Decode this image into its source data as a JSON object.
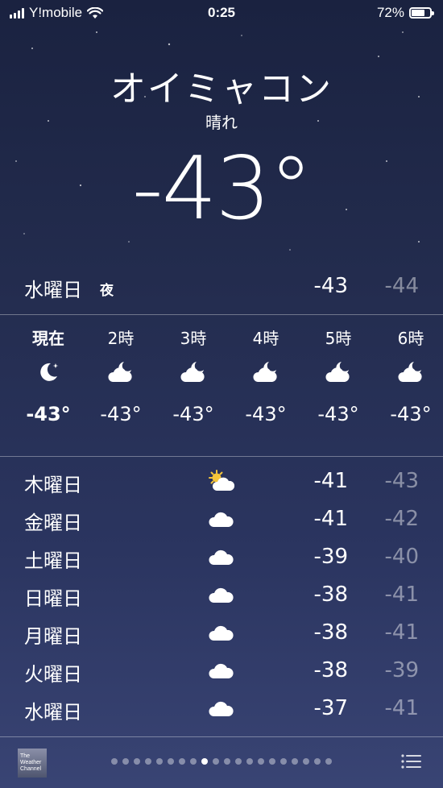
{
  "status_bar": {
    "carrier": "Y!mobile",
    "time": "0:25",
    "battery": "72%"
  },
  "location": {
    "city": "オイミャコン",
    "condition": "晴れ",
    "current_temp": "-43°"
  },
  "today": {
    "day": "水曜日",
    "tag": "夜",
    "high": "-43",
    "low": "-44"
  },
  "hourly": [
    {
      "label": "現在",
      "icon": "moon-icon",
      "temp": "-43°"
    },
    {
      "label": "2時",
      "icon": "moon-cloud-icon",
      "temp": "-43°"
    },
    {
      "label": "3時",
      "icon": "moon-cloud-icon",
      "temp": "-43°"
    },
    {
      "label": "4時",
      "icon": "moon-cloud-icon",
      "temp": "-43°"
    },
    {
      "label": "5時",
      "icon": "moon-cloud-icon",
      "temp": "-43°"
    },
    {
      "label": "6時",
      "icon": "moon-cloud-icon",
      "temp": "-43°"
    }
  ],
  "daily": [
    {
      "day": "木曜日",
      "icon": "sun-cloud-icon",
      "high": "-41",
      "low": "-43"
    },
    {
      "day": "金曜日",
      "icon": "cloud-icon",
      "high": "-41",
      "low": "-42"
    },
    {
      "day": "土曜日",
      "icon": "cloud-icon",
      "high": "-39",
      "low": "-40"
    },
    {
      "day": "日曜日",
      "icon": "cloud-icon",
      "high": "-38",
      "low": "-41"
    },
    {
      "day": "月曜日",
      "icon": "cloud-icon",
      "high": "-38",
      "low": "-41"
    },
    {
      "day": "火曜日",
      "icon": "cloud-icon",
      "high": "-38",
      "low": "-39"
    },
    {
      "day": "水曜日",
      "icon": "cloud-icon",
      "high": "-37",
      "low": "-41"
    }
  ],
  "bottom": {
    "logo_text": "The Weather Channel",
    "page_count": 20,
    "active_page": 8
  }
}
